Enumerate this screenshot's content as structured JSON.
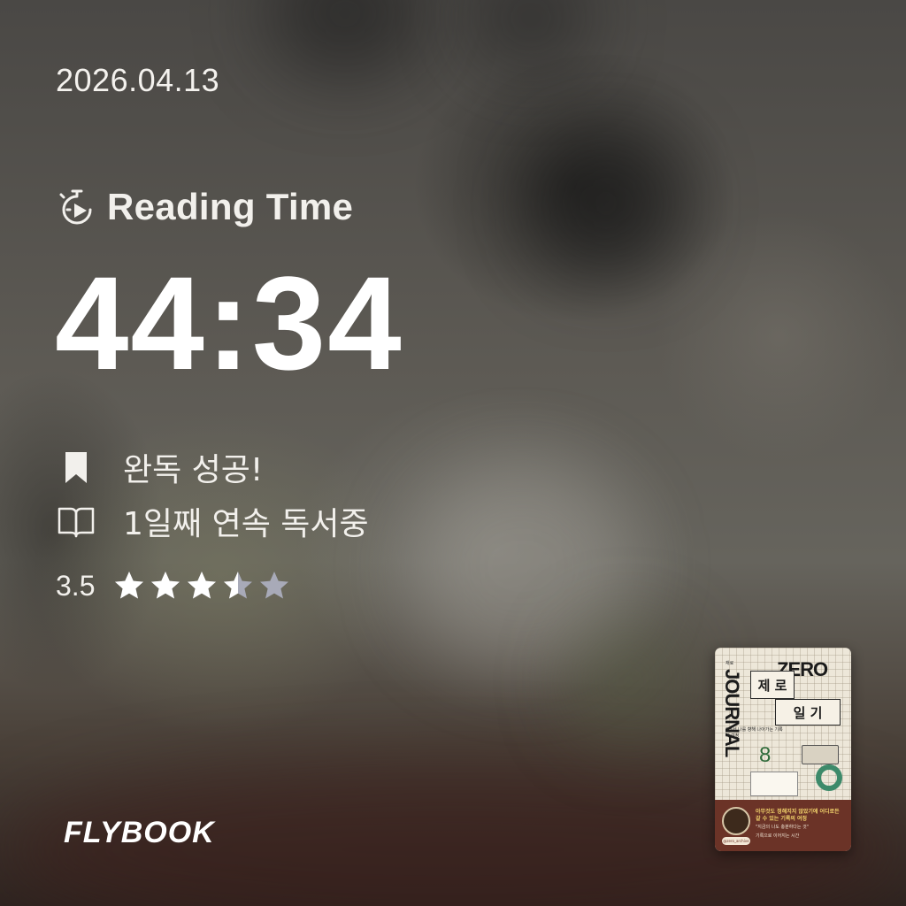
{
  "date": "2026.04.13",
  "reading": {
    "label": "Reading Time",
    "icon": "stopwatch-icon",
    "time": "44:34"
  },
  "status": {
    "completion": {
      "icon": "bookmark-icon",
      "text": "완독 성공!"
    },
    "streak": {
      "icon": "open-book-icon",
      "text": "1일째 연속 독서중"
    }
  },
  "rating": {
    "value": "3.5",
    "score": 3.5,
    "max": 5,
    "filled_color": "#ffffff",
    "empty_color": "#a8aab8"
  },
  "brand": {
    "logo": "FLYBOOK"
  },
  "book_cover": {
    "author": "채료",
    "title_en_top": "ZERO",
    "title_en_side": "JOURNAL",
    "title_ko_1": "제 로",
    "title_ko_2": "일 기",
    "subtitle": "0에서 나를 향해 나아가는 기록의 여정",
    "band_headline": "아무것도 정해지지 않았기에 어디로든 갈 수 있는 기록의 여정",
    "band_line_2": "\"지금의 나도 충분하다는 것\"",
    "band_line_3": "기록으로 이어지는 시간",
    "handle": "@zero_archive"
  }
}
